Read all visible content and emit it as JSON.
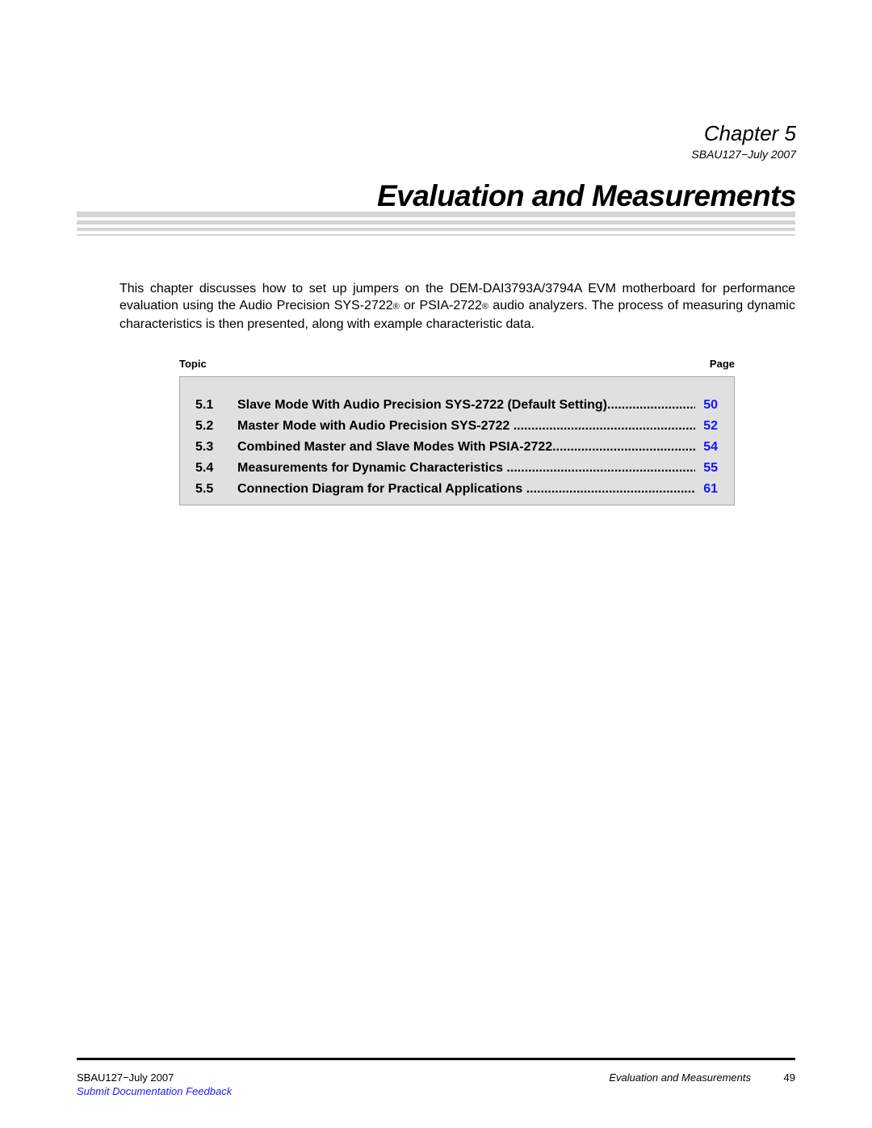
{
  "header": {
    "chapter": "Chapter 5",
    "doc_id": "SBAU127−July 2007",
    "title": "Evaluation and Measurements"
  },
  "intro": {
    "part1": "This chapter discusses how to set up jumpers on the DEM-DAI3793A/3794A EVM motherboard for performance evaluation using the Audio Precision SYS-2722",
    "reg_mark": "®",
    "part2": " or PSIA-2722",
    "part3": " audio analyzers. The process of measuring dynamic characteristics is then presented, along with example characteristic data."
  },
  "toc": {
    "topic_label": "Topic",
    "page_label": "Page",
    "entries": [
      {
        "num": "5.1",
        "title": "Slave Mode With Audio Precision SYS-2722 (Default Setting)",
        "page": "50"
      },
      {
        "num": "5.2",
        "title": "Master Mode with Audio Precision SYS-2722 ",
        "page": "52"
      },
      {
        "num": "5.3",
        "title": "Combined Master and Slave Modes With PSIA-2722",
        "page": "54"
      },
      {
        "num": "5.4",
        "title": "Measurements for Dynamic Characteristics ",
        "page": "55"
      },
      {
        "num": "5.5",
        "title": "Connection Diagram for Practical Applications ",
        "page": "61"
      }
    ],
    "leader": "...................................................................................................."
  },
  "footer": {
    "doc_id": "SBAU127−July 2007",
    "feedback_link": "Submit Documentation Feedback",
    "section_title": "Evaluation and Measurements",
    "page_number": "49"
  },
  "colors": {
    "link": "#1414ff",
    "toc_background": "#e0e0e0",
    "decor_bars": "#d4d4d4"
  }
}
